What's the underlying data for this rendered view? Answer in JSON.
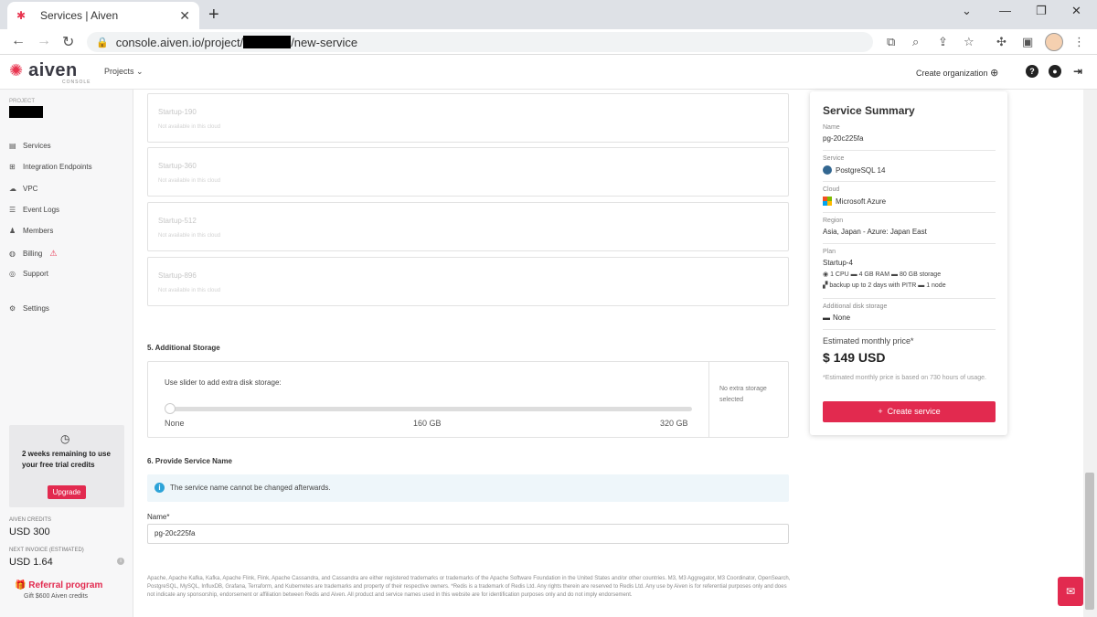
{
  "browser": {
    "tab_title": "Services | Aiven",
    "url_prefix": "console.aiven.io/project/",
    "url_suffix": "/new-service"
  },
  "header": {
    "logo": "aiven",
    "logo_sub": "CONSOLE",
    "projects_label": "Projects",
    "create_org_label": "Create organization"
  },
  "sidebar": {
    "project_label": "PROJECT",
    "items": [
      {
        "label": "Services",
        "icon": "server-icon"
      },
      {
        "label": "Integration Endpoints",
        "icon": "plug-icon"
      },
      {
        "label": "VPC",
        "icon": "cloud-icon"
      },
      {
        "label": "Event Logs",
        "icon": "list-icon"
      },
      {
        "label": "Members",
        "icon": "users-icon"
      },
      {
        "label": "Billing",
        "icon": "wallet-icon"
      },
      {
        "label": "Support",
        "icon": "support-icon"
      },
      {
        "label": "Settings",
        "icon": "gear-icon"
      }
    ],
    "trial_text": "2 weeks remaining to use your free trial credits",
    "upgrade_label": "Upgrade",
    "credits_label": "AIVEN CREDITS",
    "credits_value": "USD 300",
    "invoice_label": "NEXT INVOICE (ESTIMATED)",
    "invoice_value": "USD 1.64",
    "referral_label": "Referral program",
    "referral_note": "Gift $600 Aiven credits"
  },
  "plans": [
    {
      "name": "Startup-190",
      "note": "Not available in this cloud"
    },
    {
      "name": "Startup-360",
      "note": "Not available in this cloud"
    },
    {
      "name": "Startup-512",
      "note": "Not available in this cloud"
    },
    {
      "name": "Startup-896",
      "note": "Not available in this cloud"
    }
  ],
  "storage": {
    "title": "5. Additional Storage",
    "hint": "Use slider to add extra disk storage:",
    "tick_min": "None",
    "tick_mid": "160 GB",
    "tick_max": "320 GB",
    "no_extra": "No extra storage selected"
  },
  "service_name": {
    "title": "6. Provide Service Name",
    "notice": "The service name cannot be changed afterwards.",
    "label": "Name*",
    "value": "pg-20c225fa"
  },
  "footer": "Apache, Apache Kafka, Kafka, Apache Flink, Flink, Apache Cassandra, and Cassandra are either registered trademarks or trademarks of the Apache Software Foundation in the United States and/or other countries. M3, M3 Aggregator, M3 Coordinator, OpenSearch, PostgreSQL, MySQL, InfluxDB, Grafana, Terraform, and Kubernetes are trademarks and property of their respective owners. *Redis is a trademark of Redis Ltd. Any rights therein are reserved to Redis Ltd. Any use by Aiven is for referential purposes only and does not indicate any sponsorship, endorsement or affiliation between Redis and Aiven. All product and service names used in this website are for identification purposes only and do not imply endorsement.",
  "summary": {
    "title": "Service Summary",
    "name_label": "Name",
    "name_value": "pg-20c225fa",
    "service_label": "Service",
    "service_value": "PostgreSQL 14",
    "cloud_label": "Cloud",
    "cloud_value": "Microsoft Azure",
    "region_label": "Region",
    "region_value": "Asia, Japan - Azure: Japan East",
    "plan_label": "Plan",
    "plan_value": "Startup-4",
    "spec_cpu": "1 CPU",
    "spec_ram": "4 GB RAM",
    "spec_storage": "80 GB storage",
    "spec_backup": "backup up to 2 days with PITR",
    "spec_nodes": "1 node",
    "disk_label": "Additional disk storage",
    "disk_value": "None",
    "est_label": "Estimated monthly price*",
    "est_value": "$ 149 USD",
    "est_note": "*Estimated monthly price is based on 730 hours of usage.",
    "create_label": "Create service"
  }
}
